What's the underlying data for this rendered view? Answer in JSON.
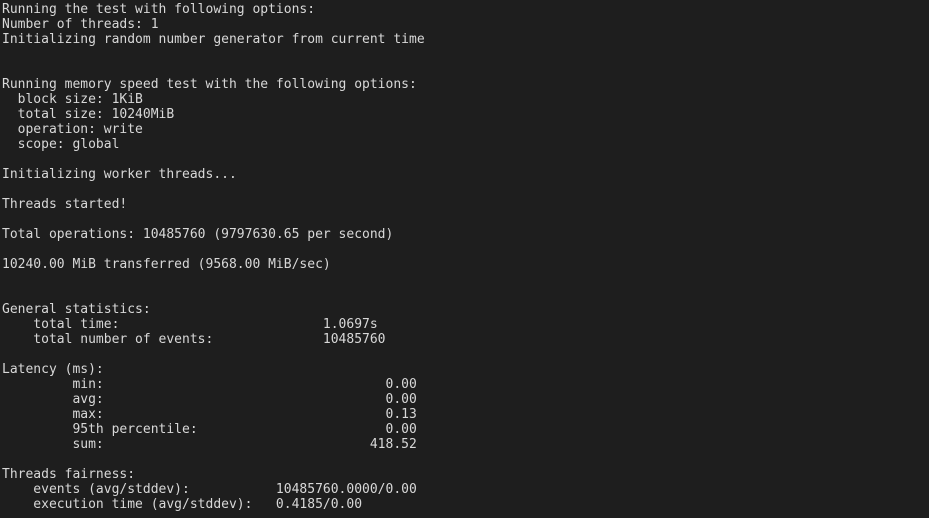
{
  "terminal": {
    "lines": [
      "Running the test with following options:",
      "Number of threads: 1",
      "Initializing random number generator from current time",
      "",
      "",
      "Running memory speed test with the following options:",
      "  block size: 1KiB",
      "  total size: 10240MiB",
      "  operation: write",
      "  scope: global",
      "",
      "Initializing worker threads...",
      "",
      "Threads started!",
      "",
      "Total operations: 10485760 (9797630.65 per second)",
      "",
      "10240.00 MiB transferred (9568.00 MiB/sec)",
      "",
      "",
      "General statistics:",
      "    total time:                          1.0697s",
      "    total number of events:              10485760",
      "",
      "Latency (ms):",
      "         min:                                    0.00",
      "         avg:                                    0.00",
      "         max:                                    0.13",
      "         95th percentile:                        0.00",
      "         sum:                                  418.52",
      "",
      "Threads fairness:",
      "    events (avg/stddev):           10485760.0000/0.00",
      "    execution time (avg/stddev):   0.4185/0.00"
    ]
  }
}
